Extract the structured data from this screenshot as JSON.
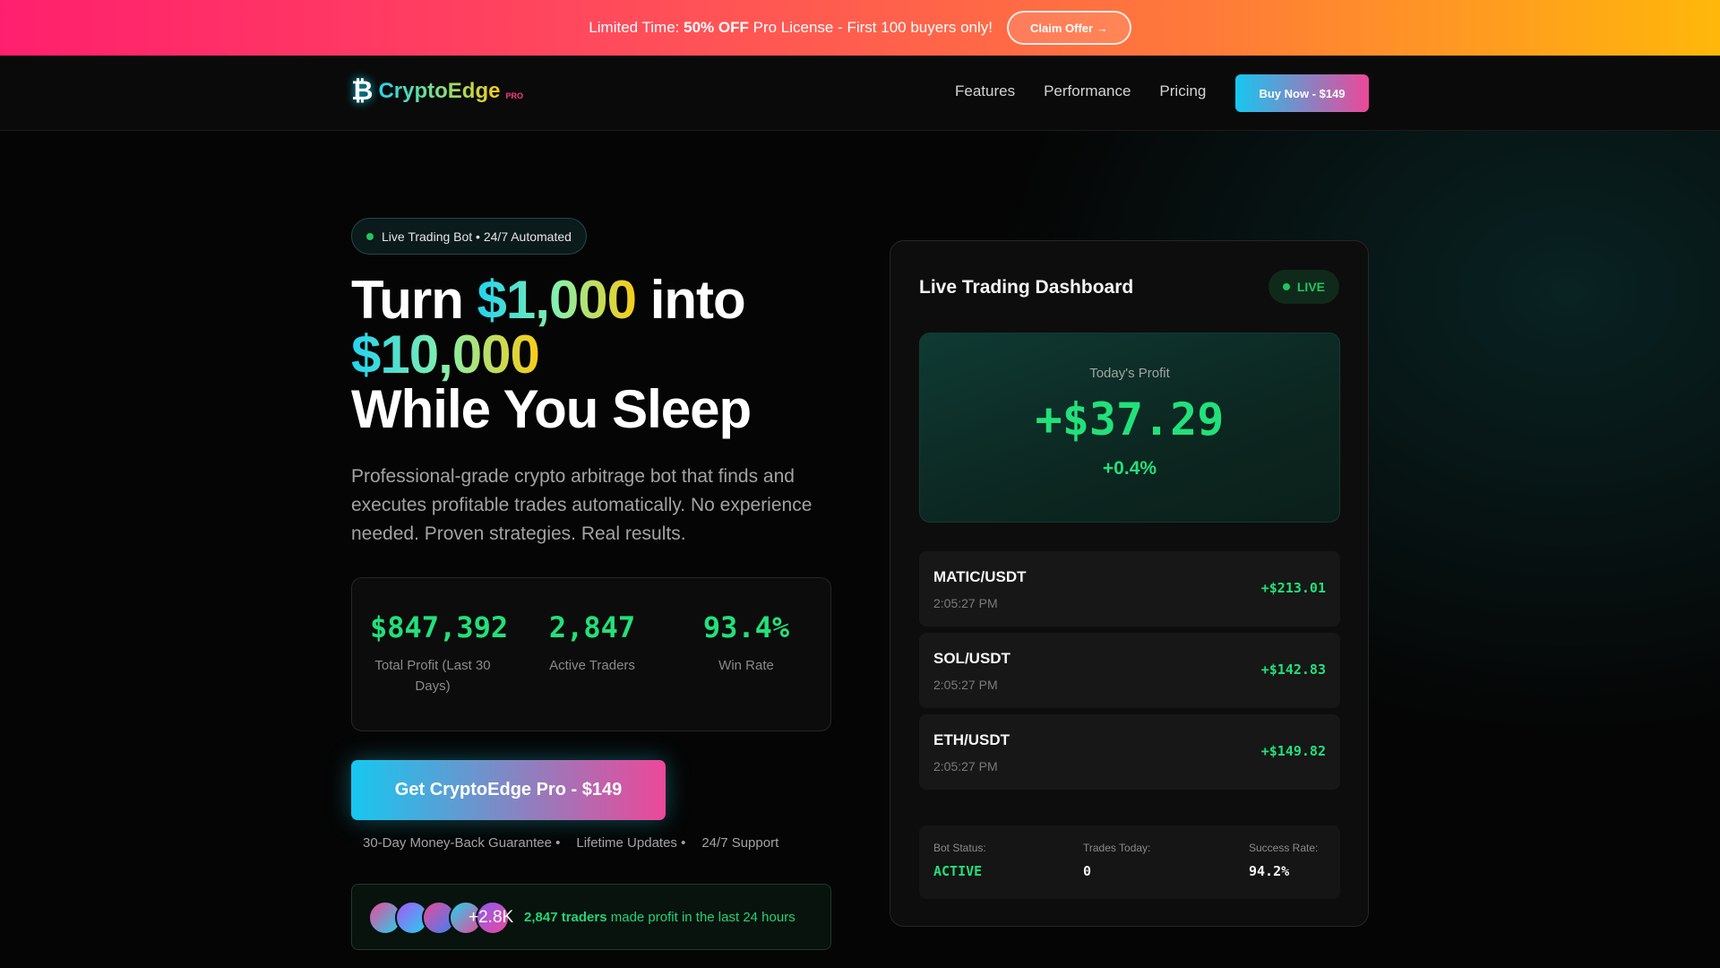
{
  "promo": {
    "lead": "Limited Time:",
    "highlight": "50% OFF",
    "rest": "Pro License - First 100 buyers only!",
    "button": "Claim Offer →"
  },
  "nav": {
    "logo_mark": "₿",
    "logo_text": "CryptoEdge",
    "logo_badge": "PRO",
    "links": [
      "Features",
      "Performance",
      "Pricing"
    ],
    "buy_button": "Buy Now - $149"
  },
  "hero": {
    "badge": "Live Trading Bot • 24/7 Automated",
    "headline_1a": "Turn ",
    "headline_1b": "$1,000",
    "headline_1c": " into",
    "headline_2": "$10,000",
    "headline_3": "While You Sleep",
    "subtext": "Professional-grade crypto arbitrage bot that finds and executes profitable trades automatically. No experience needed. Proven strategies. Real results.",
    "stats": [
      {
        "value": "$847,392",
        "label": "Total Profit (Last 30 Days)"
      },
      {
        "value": "2,847",
        "label": "Active Traders"
      },
      {
        "value": "93.4%",
        "label": "Win Rate"
      }
    ],
    "cta": "Get CryptoEdge Pro - $149",
    "guarantees": [
      "30-Day Money-Back Guarantee •",
      "Lifetime Updates •",
      "24/7 Support"
    ],
    "social": {
      "avatar_more": "+2.8K",
      "count": "2,847 traders",
      "text": " made profit in the last 24 hours"
    }
  },
  "dashboard": {
    "title": "Live Trading Dashboard",
    "live": "LIVE",
    "profit_label": "Today's Profit",
    "profit_value": "+$37.29",
    "profit_pct": "+0.4%",
    "trades": [
      {
        "pair": "MATIC/USDT",
        "time": "2:05:27 PM",
        "amount": "+$213.01"
      },
      {
        "pair": "SOL/USDT",
        "time": "2:05:27 PM",
        "amount": "+$142.83"
      },
      {
        "pair": "ETH/USDT",
        "time": "2:05:27 PM",
        "amount": "+$149.82"
      }
    ],
    "status": {
      "bot_label": "Bot Status:",
      "bot_value": "ACTIVE",
      "trades_label": "Trades Today:",
      "trades_value": "0",
      "success_label": "Success Rate:",
      "success_value": "94.2%"
    }
  },
  "colors": {
    "accent_green": "#22e07a",
    "brand_cyan": "#16c7f0",
    "brand_pink": "#ec4899",
    "promo_start": "#ff1f6e",
    "promo_end": "#ffb80a"
  }
}
